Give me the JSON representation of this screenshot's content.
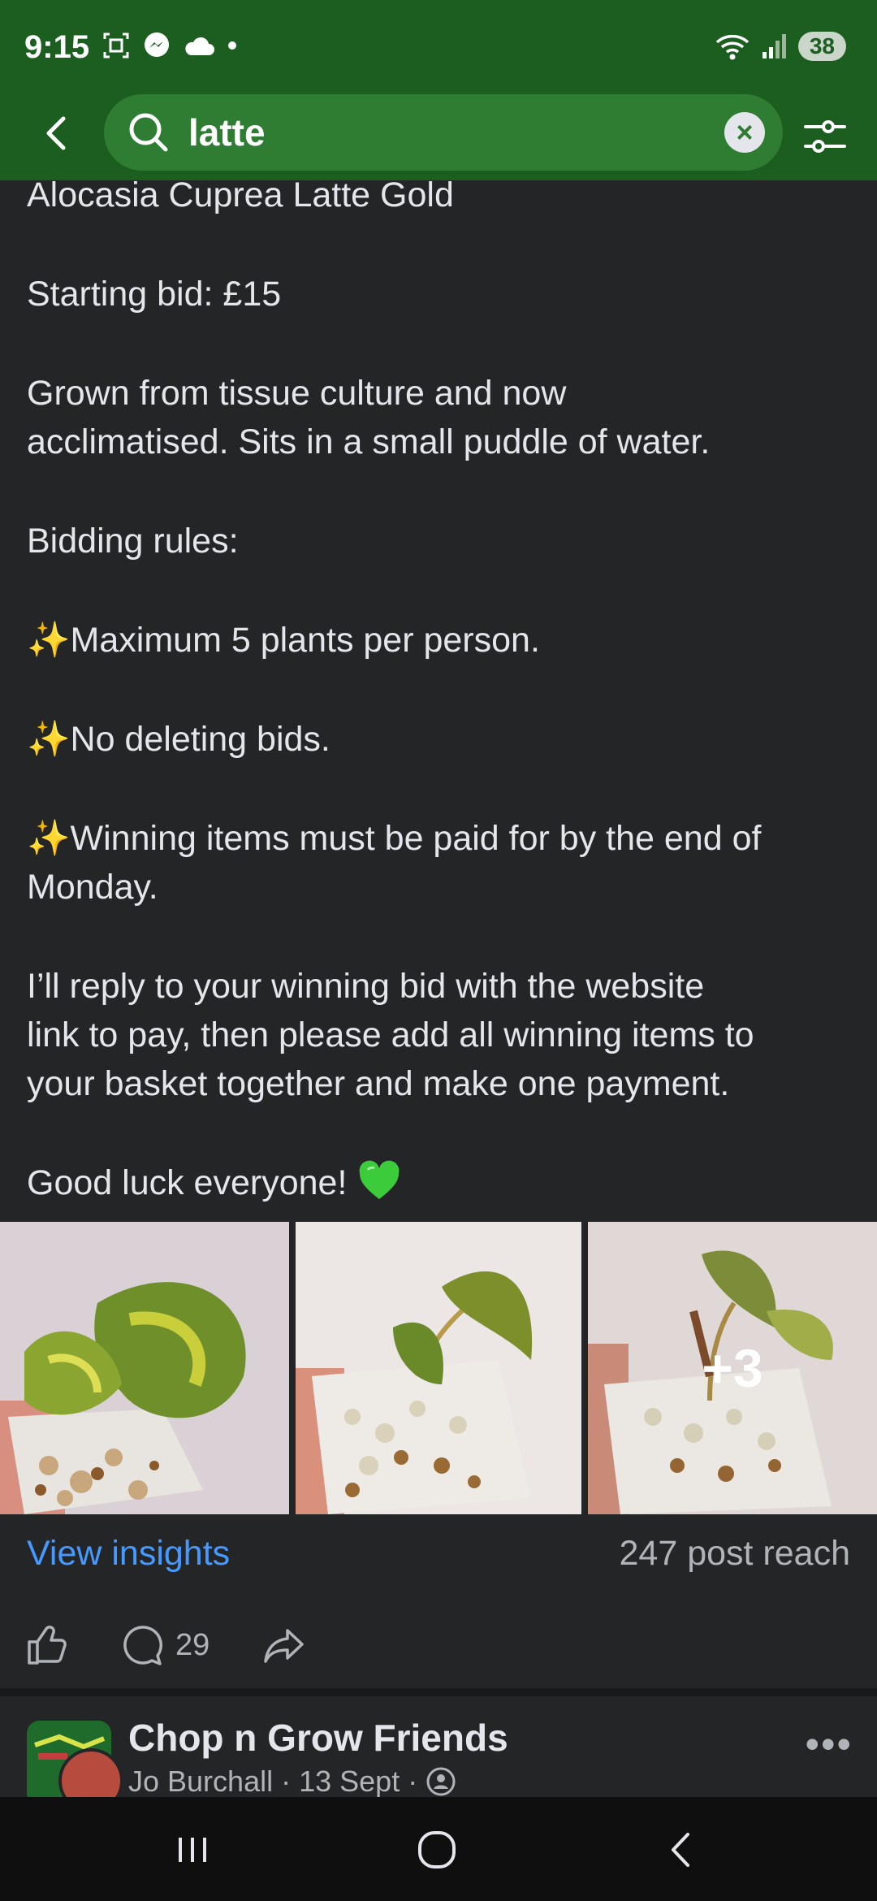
{
  "status_bar": {
    "time": "9:15",
    "battery": "38",
    "left_icons": [
      "screenshot-icon",
      "messenger-icon",
      "cloud-icon",
      "dot-icon"
    ],
    "right_icons": [
      "wifi-icon",
      "signal-icon",
      "battery-icon"
    ]
  },
  "search": {
    "query": "latte",
    "icons": [
      "back-arrow-icon",
      "search-icon",
      "clear-icon",
      "filter-icon"
    ]
  },
  "post": {
    "lines": [
      "Alocasia Cuprea Latte Gold",
      "Starting bid: £15",
      "Grown from tissue culture and now",
      "acclimatised. Sits in a small puddle of water.",
      "Bidding rules:",
      "Maximum 5 plants per person.",
      "No deleting bids.",
      "Winning items must be paid for by the end of",
      "Monday.",
      "I’ll reply to your winning bid with the website",
      "link to pay, then please add all winning items to",
      "your basket together and make one payment.",
      "Good luck everyone!"
    ],
    "sparkle": "✨",
    "photo_more_count": "+3",
    "view_insights": "View insights",
    "reach": "247 post reach",
    "comment_count": "29"
  },
  "next_post": {
    "group_name": "Chop n Grow Friends",
    "author": "Jo Burchall",
    "date": "13 Sept",
    "separator": "·",
    "more": "•••"
  },
  "colors": {
    "header_green": "#1B5E20",
    "search_field": "#2E7D32",
    "background": "#242527",
    "link_blue": "#4599FF",
    "secondary_text": "#B0B3B8"
  }
}
